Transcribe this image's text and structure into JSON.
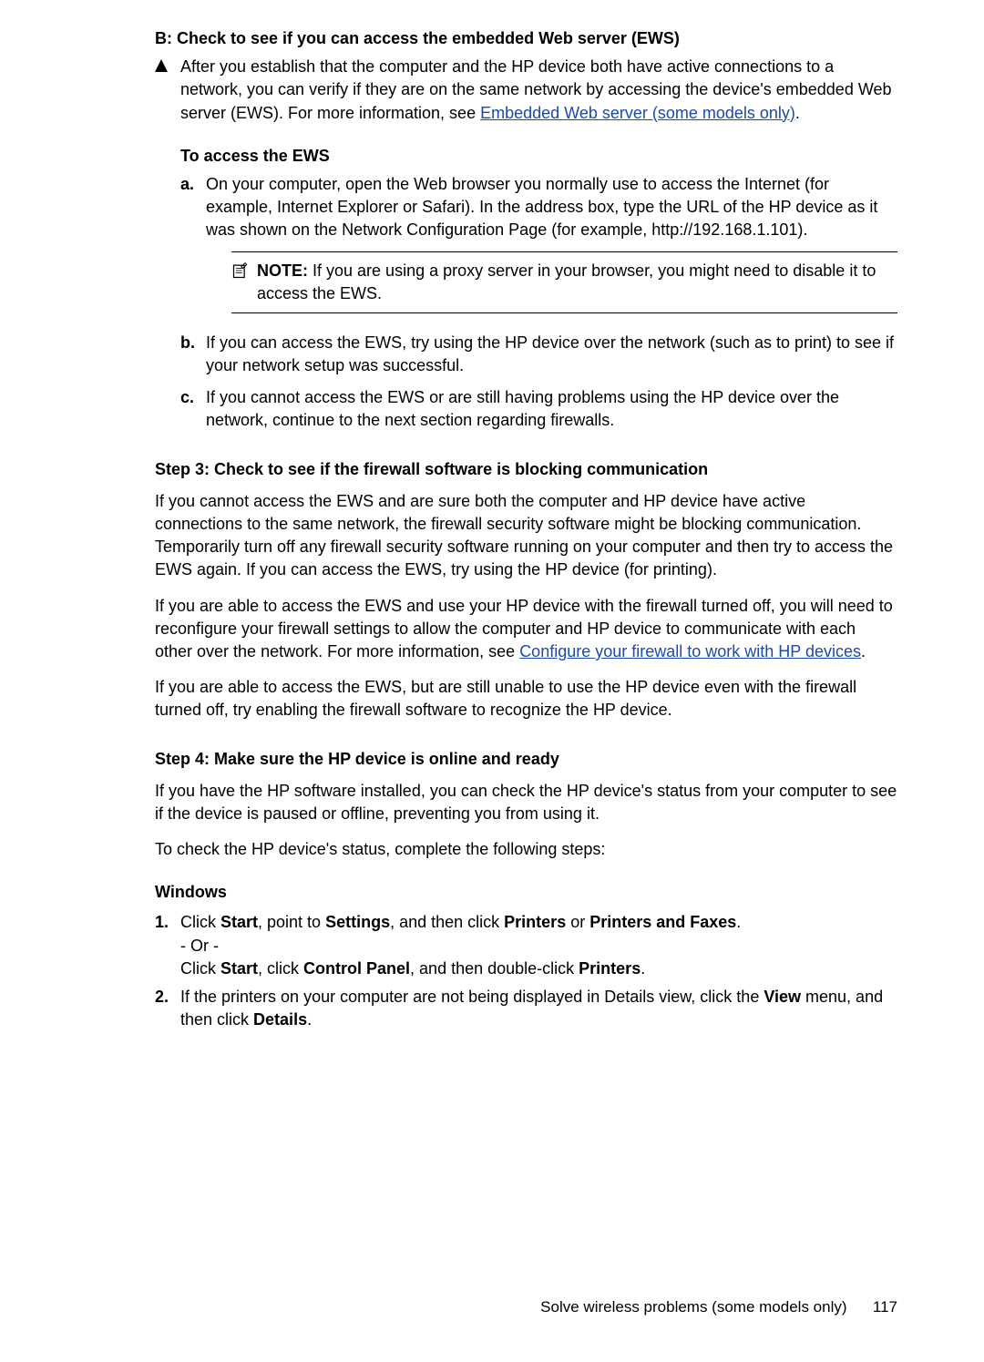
{
  "sectionB": {
    "heading": "B: Check to see if you can access the embedded Web server (EWS)",
    "body_part1": "After you establish that the computer and the HP device both have active connections to a network, you can verify if they are on the same network by accessing the device's embedded Web server (EWS). For more information, see ",
    "link": "Embedded Web server (some models only)",
    "body_part2": "."
  },
  "accessEWS": {
    "heading": "To access the EWS",
    "a": "On your computer, open the Web browser you normally use to access the Internet (for example, Internet Explorer or Safari). In the address box, type the URL of the HP device as it was shown on the Network Configuration Page (for example, http://192.168.1.101).",
    "note_label": "NOTE:",
    "note_body": "If you are using a proxy server in your browser, you might need to disable it to access the EWS.",
    "b": "If you can access the EWS, try using the HP device over the network (such as to print) to see if your network setup was successful.",
    "c": "If you cannot access the EWS or are still having problems using the HP device over the network, continue to the next section regarding firewalls."
  },
  "step3": {
    "heading": "Step 3: Check to see if the firewall software is blocking communication",
    "p1": "If you cannot access the EWS and are sure both the computer and HP device have active connections to the same network, the firewall security software might be blocking communication. Temporarily turn off any firewall security software running on your computer and then try to access the EWS again. If you can access the EWS, try using the HP device (for printing).",
    "p2_part1": "If you are able to access the EWS and use your HP device with the firewall turned off, you will need to reconfigure your firewall settings to allow the computer and HP device to communicate with each other over the network. For more information, see ",
    "p2_link": "Configure your firewall to work with HP devices",
    "p2_part2": ".",
    "p3": "If you are able to access the EWS, but are still unable to use the HP device even with the firewall turned off, try enabling the firewall software to recognize the HP device."
  },
  "step4": {
    "heading": "Step 4: Make sure the HP device is online and ready",
    "p1": "If you have the HP software installed, you can check the HP device's status from your computer to see if the device is paused or offline, preventing you from using it.",
    "p2": "To check the HP device's status, complete the following steps:"
  },
  "windows": {
    "heading": "Windows",
    "item1_a": "Click ",
    "item1_b": "Start",
    "item1_c": ", point to ",
    "item1_d": "Settings",
    "item1_e": ", and then click ",
    "item1_f": "Printers",
    "item1_g": " or ",
    "item1_h": "Printers and Faxes",
    "item1_i": ".",
    "or": "- Or -",
    "item1_alt_a": "Click ",
    "item1_alt_b": "Start",
    "item1_alt_c": ", click ",
    "item1_alt_d": "Control Panel",
    "item1_alt_e": ", and then double-click ",
    "item1_alt_f": "Printers",
    "item1_alt_g": ".",
    "item2_a": "If the printers on your computer are not being displayed in Details view, click the ",
    "item2_b": "View",
    "item2_c": " menu, and then click ",
    "item2_d": "Details",
    "item2_e": "."
  },
  "footer": {
    "text": "Solve wireless problems (some models only)",
    "page": "117"
  }
}
